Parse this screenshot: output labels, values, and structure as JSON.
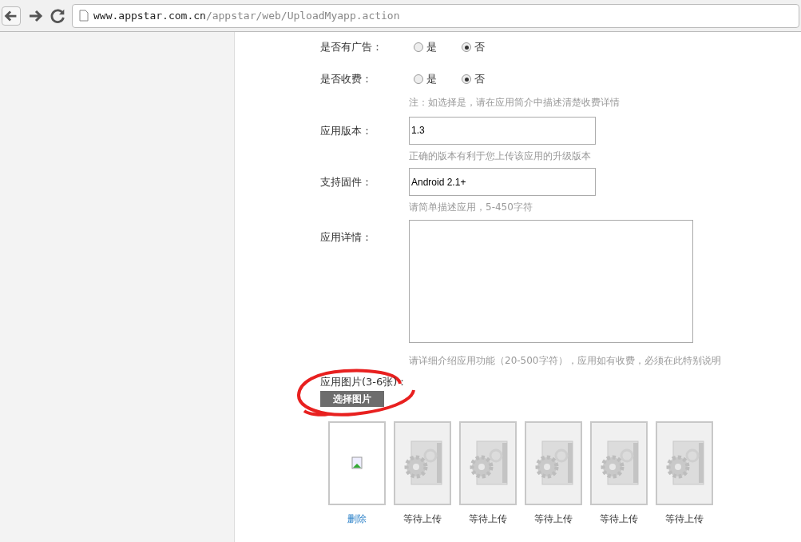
{
  "browser": {
    "url_host": "www.appstar.com.cn",
    "url_path": "/appstar/web/UploadMyapp.action"
  },
  "form": {
    "radio_groups": [
      {
        "label": "是否有广告：",
        "options": [
          {
            "label": "是",
            "selected": false
          },
          {
            "label": "否",
            "selected": true
          }
        ]
      },
      {
        "label": "是否收费：",
        "options": [
          {
            "label": "是",
            "selected": false
          },
          {
            "label": "否",
            "selected": true
          }
        ],
        "note": "注：如选择是，请在应用简介中描述清楚收费详情"
      }
    ],
    "fields": [
      {
        "kind": "input",
        "label": "应用版本：",
        "value": "1.3",
        "hint": "正确的版本有利于您上传该应用的升级版本"
      },
      {
        "kind": "input",
        "label": "支持固件：",
        "value": "Android 2.1+",
        "hint": "请简单描述应用，5-450字符"
      },
      {
        "kind": "textarea",
        "label": "应用详情：",
        "hint": "请详细介绍应用功能（20-500字符），应用如有收费，必须在此特别说明"
      }
    ],
    "images": {
      "label": "应用图片(3-6张)：",
      "button": "选择图片",
      "circled": true,
      "slots": [
        {
          "kind": "broken",
          "caption": "删除"
        },
        {
          "kind": "pending",
          "caption": "等待上传"
        },
        {
          "kind": "pending",
          "caption": "等待上传"
        },
        {
          "kind": "pending",
          "caption": "等待上传"
        },
        {
          "kind": "pending",
          "caption": "等待上传"
        },
        {
          "kind": "pending",
          "caption": "等待上传"
        }
      ]
    }
  }
}
